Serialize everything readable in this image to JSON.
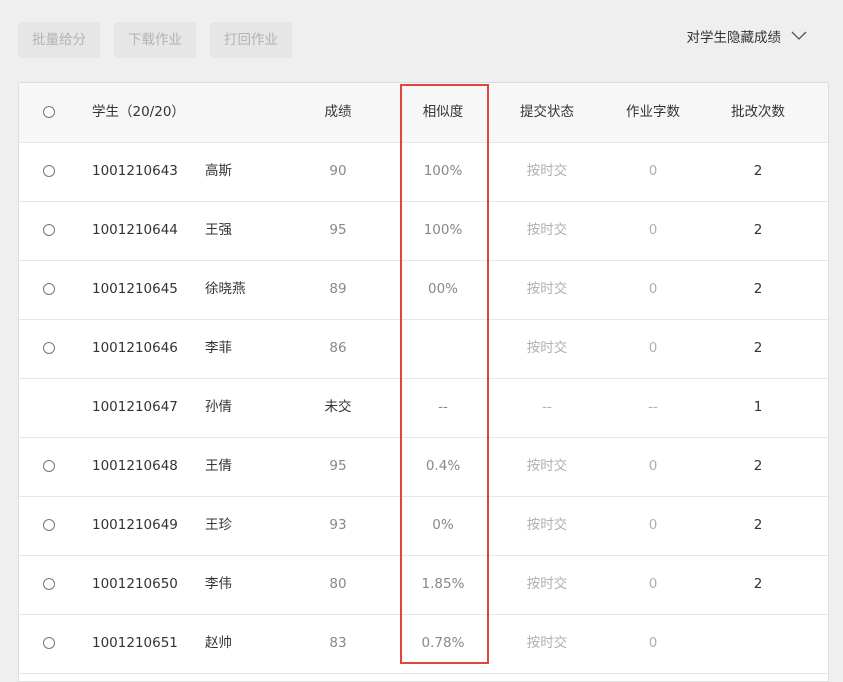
{
  "toolbar": {
    "batch_grade": "批量给分",
    "download": "下载作业",
    "return": "打回作业"
  },
  "hide_toggle": {
    "label": "对学生隐藏成绩",
    "icon": "chevron-down-icon"
  },
  "table": {
    "headers": {
      "student": "学生（20/20）",
      "score": "成绩",
      "similarity": "相似度",
      "status": "提交状态",
      "words": "作业字数",
      "reviews": "批改次数"
    },
    "rows": [
      {
        "id": "1001210643",
        "name": "高斯",
        "score": "90",
        "similarity": "100%",
        "status": "按时交",
        "words": "0",
        "reviews": "2",
        "selectable": true
      },
      {
        "id": "1001210644",
        "name": "王强",
        "score": "95",
        "similarity": "100%",
        "status": "按时交",
        "words": "0",
        "reviews": "2",
        "selectable": true
      },
      {
        "id": "1001210645",
        "name": "徐晓燕",
        "score": "89",
        "similarity": "00%",
        "status": "按时交",
        "words": "0",
        "reviews": "2",
        "selectable": true
      },
      {
        "id": "1001210646",
        "name": "李菲",
        "score": "86",
        "similarity": "",
        "status": "按时交",
        "words": "0",
        "reviews": "2",
        "selectable": true
      },
      {
        "id": "1001210647",
        "name": "孙倩",
        "score": "未交",
        "similarity": "--",
        "status": "--",
        "words": "--",
        "reviews": "1",
        "selectable": false
      },
      {
        "id": "1001210648",
        "name": "王倩",
        "score": "95",
        "similarity": "0.4%",
        "status": "按时交",
        "words": "0",
        "reviews": "2",
        "selectable": true
      },
      {
        "id": "1001210649",
        "name": "王珍",
        "score": "93",
        "similarity": "0%",
        "status": "按时交",
        "words": "0",
        "reviews": "2",
        "selectable": true
      },
      {
        "id": "1001210650",
        "name": "李伟",
        "score": "80",
        "similarity": "1.85%",
        "status": "按时交",
        "words": "0",
        "reviews": "2",
        "selectable": true
      },
      {
        "id": "1001210651",
        "name": "赵帅",
        "score": "83",
        "similarity": "0.78%",
        "status": "按时交",
        "words": "0",
        "reviews": "",
        "selectable": true
      }
    ]
  },
  "colors": {
    "highlight": "#e0453f",
    "header_bg": "#f7f7f7",
    "page_bg": "#efefef"
  }
}
